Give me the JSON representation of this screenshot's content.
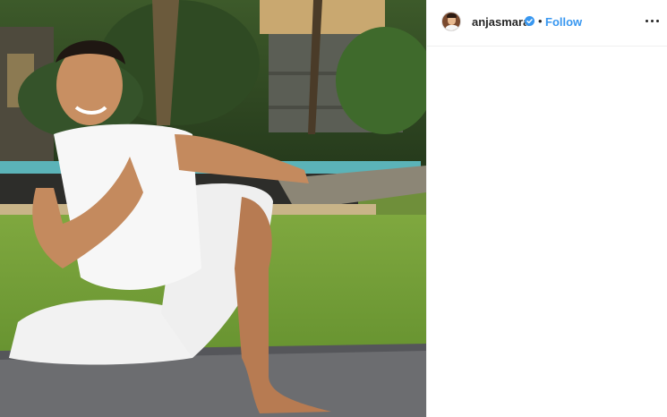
{
  "post": {
    "image_alt_icon": "photo-of-man-doing-yoga-pose",
    "author": {
      "username": "anjasmara",
      "verified": true,
      "verified_icon": "verified-badge-icon",
      "separator": "•",
      "follow_label": "Follow"
    },
    "more_icon": "more-options-icon"
  },
  "colors": {
    "accent": "#3897f0",
    "text": "#262626",
    "border": "#efefef"
  }
}
